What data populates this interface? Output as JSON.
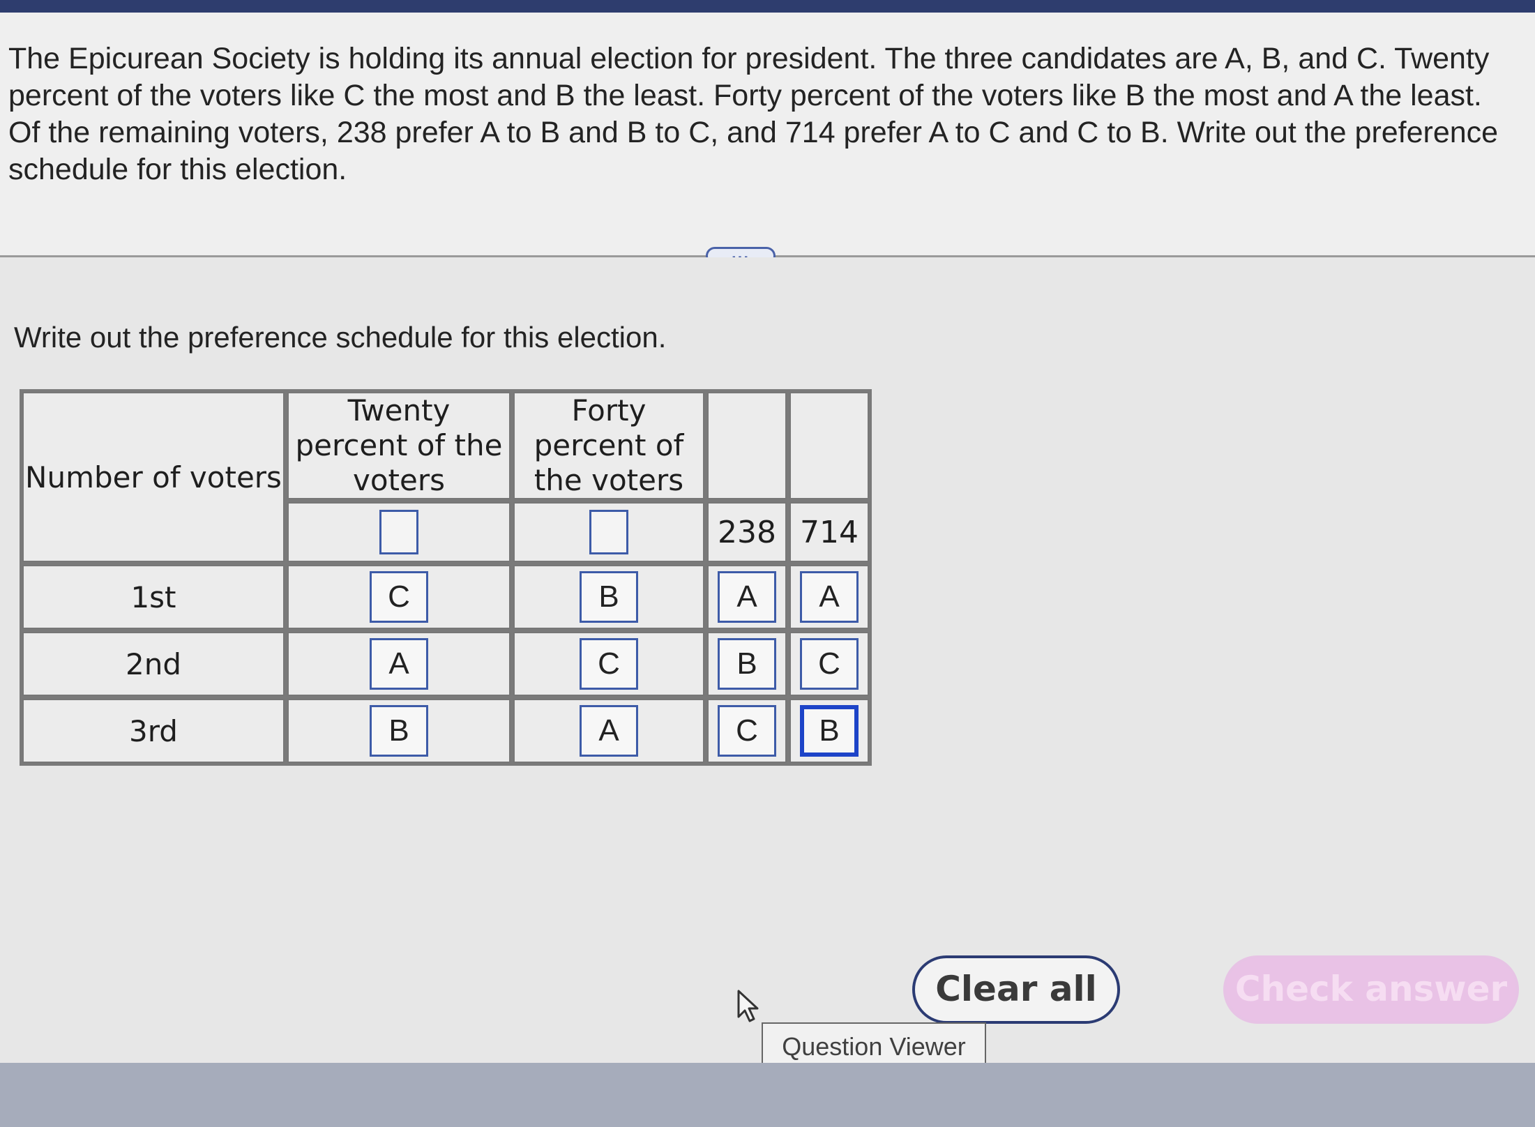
{
  "question": {
    "text": "The Epicurean Society is holding its annual election for president. The three candidates are A, B, and C. Twenty percent of the voters like C the most and B the least. Forty percent of the voters like B the most and A the least. Of the remaining voters, 238 prefer A to B and B to C, and 714 prefer A to C and C to B. Write out the preference schedule for this election."
  },
  "expand_label": "...",
  "prompt": "Write out the preference schedule for this election.",
  "table": {
    "row_header": "Number of voters",
    "col_headers": [
      "Twenty percent of the voters",
      "Forty percent of the voters",
      "",
      ""
    ],
    "counts": [
      "",
      "",
      "238",
      "714"
    ],
    "rows": [
      {
        "label": "1st",
        "cells": [
          "C",
          "B",
          "A",
          "A"
        ]
      },
      {
        "label": "2nd",
        "cells": [
          "A",
          "C",
          "B",
          "C"
        ]
      },
      {
        "label": "3rd",
        "cells": [
          "B",
          "A",
          "C",
          "B"
        ]
      }
    ]
  },
  "buttons": {
    "clear": "Clear all",
    "check": "Check answer"
  },
  "tooltip": "Question Viewer",
  "colors": {
    "accent": "#3d5ba8",
    "check_disabled": "#e9c2e6",
    "top_bar": "#2e3d6e"
  }
}
